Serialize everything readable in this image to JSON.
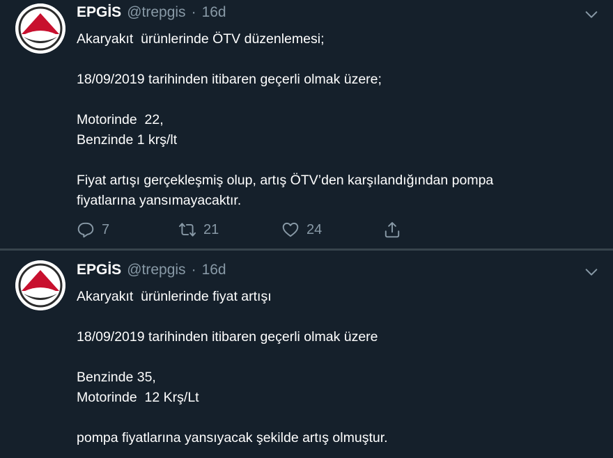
{
  "tweets": [
    {
      "author_name": "EPGİS",
      "handle": "@trepgis",
      "separator": "·",
      "time": "16d",
      "lines": [
        "Akaryakıt  ürünlerinde ÖTV düzenlemesi;",
        "",
        "18/09/2019 tarihinden itibaren geçerli olmak üzere;",
        "",
        "Motorinde  22,",
        "Benzinde 1 krş/lt",
        "",
        "Fiyat artışı gerçekleşmiş olup, artış ÖTV’den karşılandığından pompa",
        "fiyatlarına yansımayacaktır."
      ],
      "replies": "7",
      "retweets": "21",
      "likes": "24"
    },
    {
      "author_name": "EPGİS",
      "handle": "@trepgis",
      "separator": "·",
      "time": "16d",
      "lines": [
        "Akaryakıt  ürünlerinde fiyat artışı",
        "",
        "18/09/2019 tarihinden itibaren geçerli olmak üzere",
        "",
        "Benzinde 35,",
        "Motorinde  12 Krş/Lt",
        "",
        "pompa fiyatlarına yansıyacak şekilde artış olmuştur."
      ]
    }
  ],
  "icons": {
    "avatar": "epgis-logo",
    "caret": "chevron-down-icon",
    "reply": "reply-icon",
    "retweet": "retweet-icon",
    "like": "heart-icon",
    "share": "share-icon"
  },
  "colors": {
    "background": "#15202b",
    "secondary_text": "#8899a6",
    "divider": "#38444d",
    "logo_red": "#c8102e"
  }
}
